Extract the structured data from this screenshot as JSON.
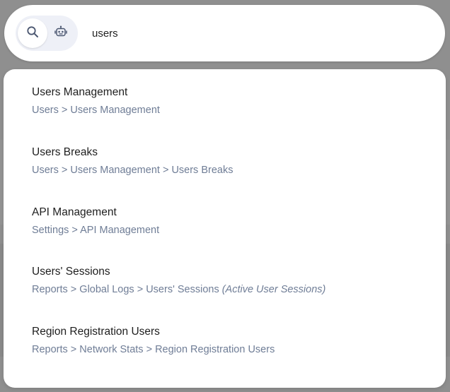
{
  "search": {
    "query": "users",
    "mode_search_icon": "search-icon",
    "mode_assistant_icon": "robot-icon"
  },
  "results": [
    {
      "title": "Users Management",
      "path": "Users > Users Management",
      "note": ""
    },
    {
      "title": "Users Breaks",
      "path": "Users > Users Management > Users Breaks",
      "note": ""
    },
    {
      "title": "API Management",
      "path": "Settings > API Management",
      "note": ""
    },
    {
      "title": "Users' Sessions",
      "path": "Reports > Global Logs > Users' Sessions",
      "note": "(Active User Sessions)"
    },
    {
      "title": "Region Registration Users",
      "path": "Reports > Network Stats > Region Registration Users",
      "note": ""
    }
  ],
  "colors": {
    "overlay": "#8f8f8f",
    "title_text": "#1e1e1e",
    "path_text": "#6f7d96",
    "toggle_bg": "#eef0f7",
    "icon": "#4a5670"
  }
}
